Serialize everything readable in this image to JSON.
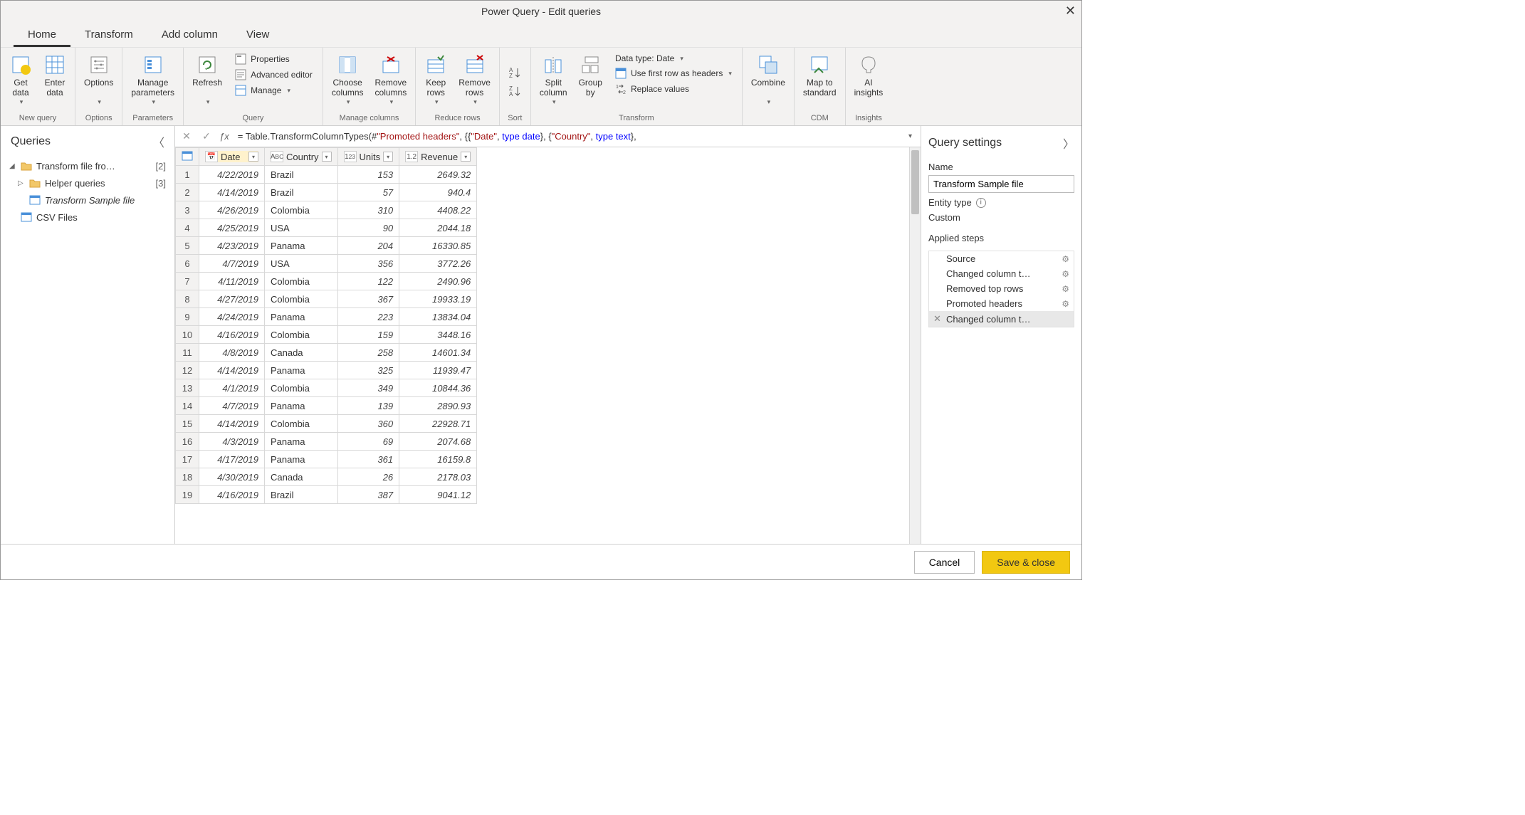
{
  "title": "Power Query - Edit queries",
  "ribbon_tabs": [
    "Home",
    "Transform",
    "Add column",
    "View"
  ],
  "active_tab": "Home",
  "ribbon": {
    "new_query": {
      "get_data": "Get\ndata",
      "enter_data": "Enter\ndata",
      "label": "New query"
    },
    "options": {
      "options": "Options",
      "label": "Options"
    },
    "parameters": {
      "manage": "Manage\nparameters",
      "label": "Parameters"
    },
    "query": {
      "refresh": "Refresh",
      "properties": "Properties",
      "advanced": "Advanced editor",
      "manage": "Manage",
      "label": "Query"
    },
    "manage_cols": {
      "choose": "Choose\ncolumns",
      "remove": "Remove\ncolumns",
      "label": "Manage columns"
    },
    "reduce": {
      "keep": "Keep\nrows",
      "remove": "Remove\nrows",
      "label": "Reduce rows"
    },
    "sort": {
      "label": "Sort"
    },
    "transform": {
      "split": "Split\ncolumn",
      "group": "Group\nby",
      "data_type": "Data type: Date",
      "first_row": "Use first row as headers",
      "replace": "Replace values",
      "label": "Transform"
    },
    "combine": {
      "combine": "Combine",
      "label": ""
    },
    "cdm": {
      "map": "Map to\nstandard",
      "label": "CDM"
    },
    "insights": {
      "ai": "AI\ninsights",
      "label": "Insights"
    }
  },
  "queries_pane": {
    "title": "Queries",
    "tree": [
      {
        "level": 0,
        "type": "folder",
        "label": "Transform file fro…",
        "count": "[2]",
        "expanded": true
      },
      {
        "level": 1,
        "type": "folder",
        "label": "Helper queries",
        "count": "[3]",
        "expanded": false
      },
      {
        "level": 1,
        "type": "query",
        "label": "Transform Sample file",
        "selected": true
      },
      {
        "level": 0,
        "type": "query",
        "label": "CSV Files"
      }
    ]
  },
  "formula_bar": {
    "parts": [
      {
        "t": "eq",
        "v": "= "
      },
      {
        "t": "fn",
        "v": "Table.TransformColumnTypes(#"
      },
      {
        "t": "str",
        "v": "\"Promoted headers\""
      },
      {
        "t": "fn",
        "v": ", {{"
      },
      {
        "t": "str",
        "v": "\"Date\""
      },
      {
        "t": "fn",
        "v": ", "
      },
      {
        "t": "kw",
        "v": "type date"
      },
      {
        "t": "fn",
        "v": "}, {"
      },
      {
        "t": "str",
        "v": "\"Country\""
      },
      {
        "t": "fn",
        "v": ", "
      },
      {
        "t": "kw",
        "v": "type text"
      },
      {
        "t": "fn",
        "v": "},"
      }
    ]
  },
  "grid": {
    "columns": [
      {
        "name": "Date",
        "type": "date",
        "selected": true
      },
      {
        "name": "Country",
        "type": "text"
      },
      {
        "name": "Units",
        "type": "int"
      },
      {
        "name": "Revenue",
        "type": "dec"
      }
    ],
    "rows": [
      [
        "4/22/2019",
        "Brazil",
        "153",
        "2649.32"
      ],
      [
        "4/14/2019",
        "Brazil",
        "57",
        "940.4"
      ],
      [
        "4/26/2019",
        "Colombia",
        "310",
        "4408.22"
      ],
      [
        "4/25/2019",
        "USA",
        "90",
        "2044.18"
      ],
      [
        "4/23/2019",
        "Panama",
        "204",
        "16330.85"
      ],
      [
        "4/7/2019",
        "USA",
        "356",
        "3772.26"
      ],
      [
        "4/11/2019",
        "Colombia",
        "122",
        "2490.96"
      ],
      [
        "4/27/2019",
        "Colombia",
        "367",
        "19933.19"
      ],
      [
        "4/24/2019",
        "Panama",
        "223",
        "13834.04"
      ],
      [
        "4/16/2019",
        "Colombia",
        "159",
        "3448.16"
      ],
      [
        "4/8/2019",
        "Canada",
        "258",
        "14601.34"
      ],
      [
        "4/14/2019",
        "Panama",
        "325",
        "11939.47"
      ],
      [
        "4/1/2019",
        "Colombia",
        "349",
        "10844.36"
      ],
      [
        "4/7/2019",
        "Panama",
        "139",
        "2890.93"
      ],
      [
        "4/14/2019",
        "Colombia",
        "360",
        "22928.71"
      ],
      [
        "4/3/2019",
        "Panama",
        "69",
        "2074.68"
      ],
      [
        "4/17/2019",
        "Panama",
        "361",
        "16159.8"
      ],
      [
        "4/30/2019",
        "Canada",
        "26",
        "2178.03"
      ],
      [
        "4/16/2019",
        "Brazil",
        "387",
        "9041.12"
      ]
    ]
  },
  "settings": {
    "title": "Query settings",
    "name_label": "Name",
    "name_value": "Transform Sample file",
    "entity_label": "Entity type",
    "entity_value": "Custom",
    "steps_label": "Applied steps",
    "steps": [
      {
        "label": "Source",
        "gear": true
      },
      {
        "label": "Changed column t…",
        "gear": true
      },
      {
        "label": "Removed top rows",
        "gear": true
      },
      {
        "label": "Promoted headers",
        "gear": true
      },
      {
        "label": "Changed column t…",
        "gear": false,
        "selected": true,
        "x": true
      }
    ]
  },
  "footer": {
    "cancel": "Cancel",
    "save": "Save & close"
  }
}
